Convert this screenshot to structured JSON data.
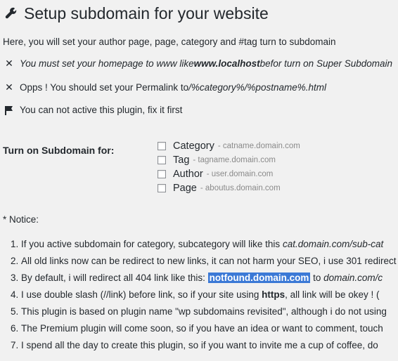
{
  "header": {
    "icon": "wrench-icon",
    "title": "Setup subdomain for your website"
  },
  "intro": "Here, you will set your author page, page, category and #tag turn to subdomain",
  "messages": [
    {
      "icon": "close-icon",
      "pre": "You must set your homepage to www like ",
      "bold": "www.localhost",
      "post": " befor turn on Super Subdomain"
    },
    {
      "icon": "close-icon",
      "pre": "Opps ! You should set your Permalink to ",
      "italic": "/%category%/%postname%.html"
    },
    {
      "icon": "flag-icon",
      "text": "You can not active this plugin, fix it first"
    }
  ],
  "settings": {
    "label": "Turn on Subdomain for:",
    "options": [
      {
        "label": "Category",
        "hint": "- catname.domain.com",
        "checked": false
      },
      {
        "label": "Tag",
        "hint": "- tagname.domain.com",
        "checked": false
      },
      {
        "label": "Author",
        "hint": "- user.domain.com",
        "checked": false
      },
      {
        "label": "Page",
        "hint": "- aboutus.domain.com",
        "checked": false
      }
    ]
  },
  "notice": {
    "heading": "* Notice:",
    "items": [
      {
        "pre": "If you active subdomain for category, subcategory will like this ",
        "italic": "cat.domain.com/sub-cat"
      },
      {
        "pre": "All old links now can be redirect to new links, it can not harm your SEO, i use 301 redirect"
      },
      {
        "pre": "By default, i will redirect all 404 link like this: ",
        "highlight": "notfound.domain.com",
        "post": " to ",
        "italic": "domain.com/c"
      },
      {
        "pre": "I use double slash (//link) before link, so if your site using ",
        "bold": "https",
        "post": ", all link will be okey ! ("
      },
      {
        "pre": "This plugin is based on plugin name \"wp subdomains revisited\", although i do not using"
      },
      {
        "pre": "The Premium plugin will come soon, so if you have an idea or want to comment, touch"
      },
      {
        "pre": "I spend all the day to create this plugin, so if you want to invite me a cup of coffee, do"
      }
    ]
  }
}
